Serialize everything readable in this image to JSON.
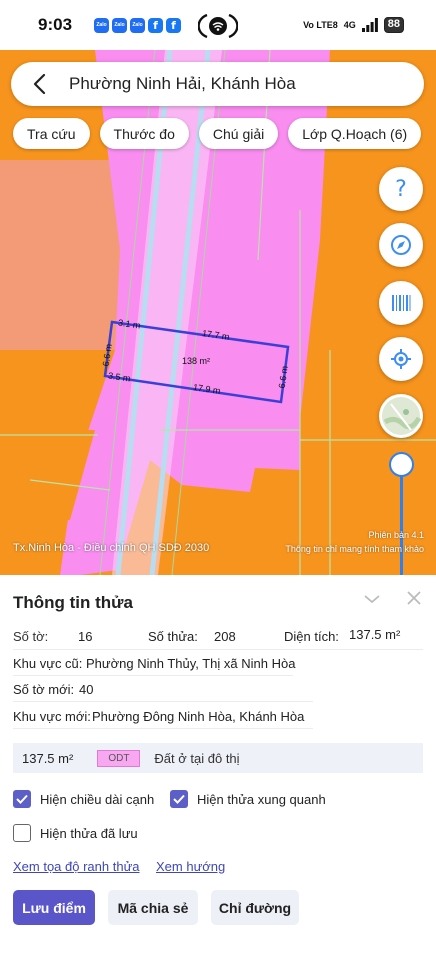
{
  "status": {
    "time": "9:03",
    "apps": [
      "Zalo",
      "Zalo",
      "Zalo",
      "f",
      "f"
    ],
    "network": "Vo LTE8",
    "signal": "4G",
    "battery": "88"
  },
  "search": {
    "location": "Phường Ninh Hải, Khánh Hòa"
  },
  "chips": [
    "Tra cứu",
    "Thước đo",
    "Chú giải",
    "Lớp Q.Hoạch (6)"
  ],
  "fab": {
    "help": "?"
  },
  "map": {
    "plot_area": "138 m²",
    "edges": {
      "top_left": "3.1 m",
      "top": "17.7 m",
      "left": "6.6 m",
      "right": "6.6 m",
      "bottom_left": "3.5 m",
      "bottom": "17.9 m"
    },
    "plan_label": "Tx.Ninh Hòa - Điều chỉnh QH SDĐ 2030",
    "version": "Phiên bản 4.1",
    "disclaimer": "Thông tin chỉ mang tính tham khảo"
  },
  "panel": {
    "title": "Thông tin thửa",
    "so_to_label": "Số tờ:",
    "so_to_value": "16",
    "so_thua_label": "Số thửa:",
    "so_thua_value": "208",
    "dien_tich_label": "Diện tích:",
    "dien_tich_value": "137.5 m²",
    "kv_cu_label": "Khu vực cũ:",
    "kv_cu_value": "Phường Ninh Thủy, Thị xã Ninh Hòa",
    "so_to_moi_label": "Số tờ mới:",
    "so_to_moi_value": "40",
    "kv_moi_label": "Khu vực mới:",
    "kv_moi_value": "Phường Đông Ninh Hòa, Khánh Hòa",
    "summary_area": "137.5 m²",
    "summary_code": "ODT",
    "summary_desc": "Đất ở tại đô thị",
    "check_length": "Hiện chiều dài cạnh",
    "check_neighbors": "Hiện thửa xung quanh",
    "check_saved": "Hiện thửa đã lưu",
    "link_coords": "Xem tọa độ ranh thửa",
    "link_direction": "Xem hướng",
    "btn_save": "Lưu điểm",
    "btn_share": "Mã chia sẻ",
    "btn_route": "Chỉ đường"
  },
  "colors": {
    "residential": "#f98df0",
    "commercial": "#f7941d",
    "accent": "#5a55c9",
    "plot_outline": "#3b3fd6"
  }
}
